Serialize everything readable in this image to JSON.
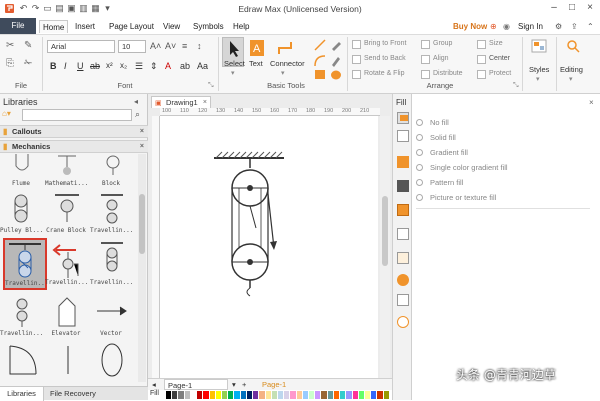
{
  "window": {
    "title": "Edraw Max (Unlicensed Version)"
  },
  "menubar": {
    "file": "File",
    "tabs": [
      "Home",
      "Insert",
      "Page Layout",
      "View",
      "Symbols",
      "Help"
    ],
    "buy_now": "Buy Now",
    "sign_in": "Sign In"
  },
  "ribbon": {
    "groups": {
      "file": "File",
      "font": "Font",
      "basic_tools": "Basic Tools",
      "arrange": "Arrange"
    },
    "font_name": "Arial",
    "font_size": "10",
    "select": "Select",
    "text": "Text",
    "connector": "Connector",
    "arrange_items": [
      "Bring to Front",
      "Send to Back",
      "Rotate & Flip",
      "Group",
      "Align",
      "Distribute",
      "Size",
      "Center",
      "Protect"
    ],
    "styles": "Styles",
    "editing": "Editing"
  },
  "libraries": {
    "title": "Libraries",
    "categories": [
      "Callouts",
      "Mechanics"
    ],
    "shapes": [
      "Flume",
      "Mathemati...",
      "Block",
      "Pulley Bl...",
      "Crane Block",
      "Travellin...",
      "Travellin...",
      "Travellin...",
      "Travellin...",
      "Travellin...",
      "Elevator",
      "Vector"
    ]
  },
  "document": {
    "tab": "Drawing1",
    "ruler_marks": [
      "100",
      "110",
      "120",
      "130",
      "140",
      "150",
      "160",
      "170",
      "180",
      "190",
      "200",
      "210"
    ]
  },
  "pagebar": {
    "page_label": "Page-1",
    "active_page": "Page-1"
  },
  "fill": {
    "title": "Fill",
    "options": [
      "No fill",
      "Solid fill",
      "Gradient fill",
      "Single color gradient fill",
      "Pattern fill",
      "Picture or texture fill"
    ]
  },
  "bottom_tabs": [
    "Libraries",
    "File Recovery"
  ],
  "watermark": "头条 @青青河边草",
  "colors": {
    "file_menu": "#3f4b5c",
    "accent_orange": "#f0932b",
    "buy_now": "#d7741a",
    "selection_red": "#d9392b",
    "page_active": "#d88a1a"
  },
  "palette_colors": [
    "#000000",
    "#404040",
    "#7f7f7f",
    "#bfbfbf",
    "#ffffff",
    "#c00000",
    "#ff0000",
    "#ffc000",
    "#ffff00",
    "#92d050",
    "#00b050",
    "#00b0f0",
    "#0070c0",
    "#002060",
    "#7030a0",
    "#f4b183",
    "#ffe699",
    "#c5e0b4",
    "#bdd7ee",
    "#d9d2e9",
    "#ff99cc",
    "#ffcc99",
    "#99ccff",
    "#ccffcc",
    "#cc99ff",
    "#996633",
    "#669999",
    "#ff6600",
    "#33cccc",
    "#9999ff",
    "#ff3399",
    "#66ff66",
    "#ffff99",
    "#3366ff",
    "#cc3300",
    "#999900"
  ]
}
